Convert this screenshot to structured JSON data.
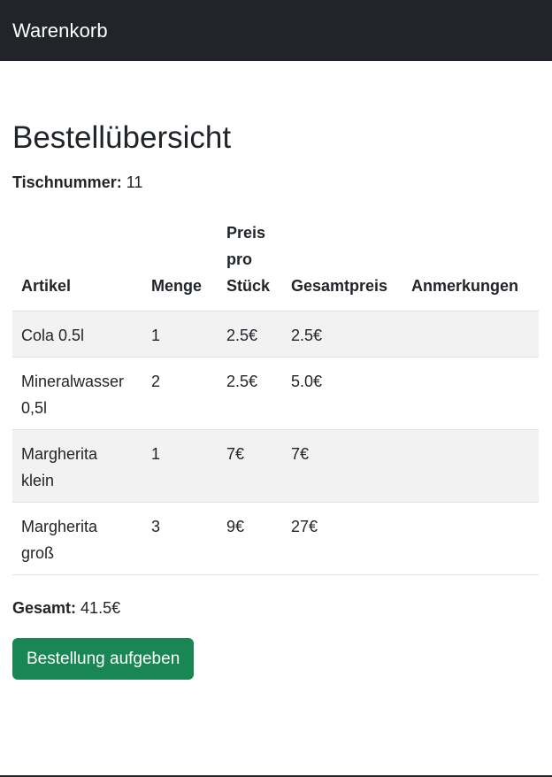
{
  "navbar": {
    "brand": "Warenkorb"
  },
  "main": {
    "title": "Bestellübersicht",
    "table_number_label": "Tischnummer:",
    "table_number_value": "11",
    "columns": [
      "Artikel",
      "Menge",
      "Preis pro Stück",
      "Gesamtpreis",
      "Anmerkungen"
    ],
    "rows": [
      {
        "artikel": "Cola 0.5l",
        "menge": "1",
        "preis": "2.5€",
        "gesamt": "2.5€",
        "anmerkungen": ""
      },
      {
        "artikel": "Mineralwasser 0,5l",
        "menge": "2",
        "preis": "2.5€",
        "gesamt": "5.0€",
        "anmerkungen": ""
      },
      {
        "artikel": "Margherita klein",
        "menge": "1",
        "preis": "7€",
        "gesamt": "7€",
        "anmerkungen": ""
      },
      {
        "artikel": "Margherita groß",
        "menge": "3",
        "preis": "9€",
        "gesamt": "27€",
        "anmerkungen": ""
      }
    ],
    "total_label": "Gesamt:",
    "total_value": "41.5€",
    "order_button_label": "Bestellung aufgeben"
  },
  "colors": {
    "navbar_bg": "#212529",
    "button_bg": "#198754",
    "stripe_bg": "#f2f2f2"
  }
}
